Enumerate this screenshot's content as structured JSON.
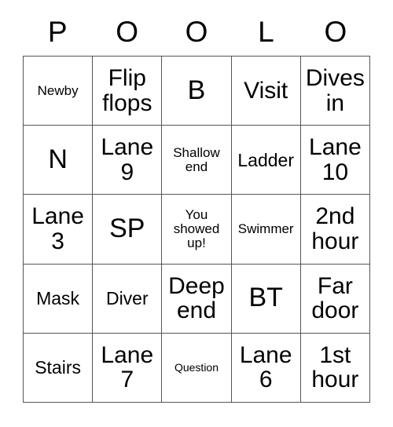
{
  "card": {
    "title_letters": [
      "P",
      "O",
      "O",
      "L",
      "O"
    ],
    "columns": 5,
    "rows": 5,
    "border_color": "#555555",
    "background_color": "#ffffff",
    "text_color": "#000000",
    "cells": [
      [
        {
          "text": "Newby",
          "size": "sm"
        },
        {
          "text": "Flip flops",
          "size": "lg"
        },
        {
          "text": "B",
          "size": "xl"
        },
        {
          "text": "Visit",
          "size": "lg"
        },
        {
          "text": "Dives in",
          "size": "lg"
        }
      ],
      [
        {
          "text": "N",
          "size": "xl"
        },
        {
          "text": "Lane 9",
          "size": "lg"
        },
        {
          "text": "Shallow end",
          "size": "sm"
        },
        {
          "text": "Ladder",
          "size": "md"
        },
        {
          "text": "Lane 10",
          "size": "lg"
        }
      ],
      [
        {
          "text": "Lane 3",
          "size": "lg"
        },
        {
          "text": "SP",
          "size": "xl"
        },
        {
          "text": "You showed up!",
          "size": "sm"
        },
        {
          "text": "Swimmer",
          "size": "sm"
        },
        {
          "text": "2nd hour",
          "size": "lg"
        }
      ],
      [
        {
          "text": "Mask",
          "size": "md"
        },
        {
          "text": "Diver",
          "size": "md"
        },
        {
          "text": "Deep end",
          "size": "lg"
        },
        {
          "text": "BT",
          "size": "xl"
        },
        {
          "text": "Far door",
          "size": "lg"
        }
      ],
      [
        {
          "text": "Stairs",
          "size": "md"
        },
        {
          "text": "Lane 7",
          "size": "lg"
        },
        {
          "text": "Question",
          "size": "xs"
        },
        {
          "text": "Lane 6",
          "size": "lg"
        },
        {
          "text": "1st hour",
          "size": "lg"
        }
      ]
    ]
  }
}
